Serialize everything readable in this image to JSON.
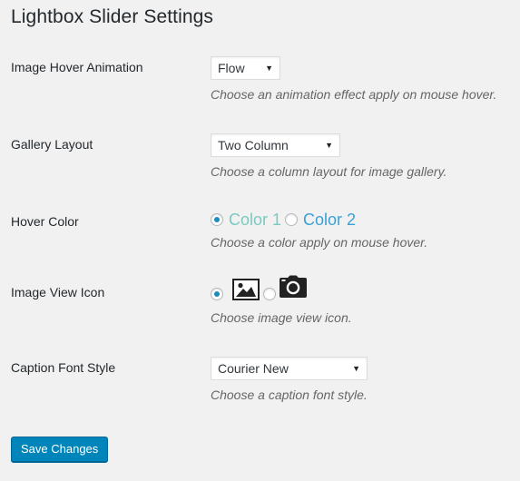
{
  "page": {
    "title": "Lightbox Slider Settings"
  },
  "settings": {
    "hover_animation": {
      "label": "Image Hover Animation",
      "selected": "Flow",
      "description": "Choose an animation effect apply on mouse hover."
    },
    "gallery_layout": {
      "label": "Gallery Layout",
      "selected": "Two Column",
      "description": "Choose a column layout for image gallery."
    },
    "hover_color": {
      "label": "Hover Color",
      "options": [
        {
          "label": "Color 1",
          "color": "#7bc9c0",
          "checked": true
        },
        {
          "label": "Color 2",
          "color": "#3aa1d6",
          "checked": false
        }
      ],
      "description": "Choose a color apply on mouse hover."
    },
    "view_icon": {
      "label": "Image View Icon",
      "options": [
        {
          "icon": "picture-icon",
          "checked": true
        },
        {
          "icon": "camera-icon",
          "checked": false
        }
      ],
      "description": "Choose image view icon."
    },
    "caption_font": {
      "label": "Caption Font Style",
      "selected": "Courier New",
      "description": "Choose a caption font style."
    }
  },
  "actions": {
    "save_label": "Save Changes"
  },
  "colors": {
    "background": "#f1f1f1",
    "primary_button": "#0085ba",
    "radio_dot": "#1e8cbe"
  }
}
